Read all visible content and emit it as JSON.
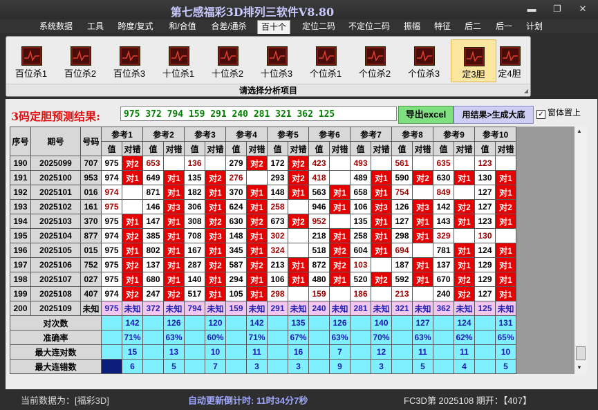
{
  "app": {
    "title": "第七感福彩3D排列三软件V8.80"
  },
  "window_controls": {
    "minimize": "▬",
    "restore": "❐",
    "close": "✕"
  },
  "menu": [
    "系统数据",
    "工具",
    "跨度/复式",
    "和/合值",
    "合差/通杀",
    "百十个",
    "定位二码",
    "不定位二码",
    "振幅",
    "特征",
    "后二",
    "后一",
    "计划"
  ],
  "ribbon": {
    "buttons": [
      "百位杀1",
      "百位杀2",
      "百位杀3",
      "十位杀1",
      "十位杀2",
      "十位杀3",
      "个位杀1",
      "个位杀2",
      "个位杀3",
      "定3胆",
      "定4胆"
    ],
    "caption": "请选择分析项目",
    "corner": "◢"
  },
  "prediction": {
    "label": "3码定胆预测结果:",
    "values": "975 372 794 159 291 240 281 321 362 125",
    "export_label": "导出excel",
    "generate_label": "用结果>生成大底",
    "topmost_label": "窗体置上",
    "topmost_check": "✓"
  },
  "table": {
    "headers": {
      "seq": "序号",
      "period": "期号",
      "number": "号码",
      "val": "值",
      "judge": "对错"
    },
    "refs": [
      "参考1",
      "参考2",
      "参考3",
      "参考4",
      "参考5",
      "参考6",
      "参考7",
      "参考8",
      "参考9",
      "参考10"
    ],
    "rows": [
      {
        "seq": "190",
        "period": "2025099",
        "number": "707",
        "cells": [
          [
            "975",
            "对2"
          ],
          [
            "653",
            ""
          ],
          [
            "136",
            ""
          ],
          [
            "279",
            "对2"
          ],
          [
            "172",
            "对2"
          ],
          [
            "423",
            ""
          ],
          [
            "493",
            ""
          ],
          [
            "561",
            ""
          ],
          [
            "635",
            ""
          ],
          [
            "123",
            ""
          ]
        ]
      },
      {
        "seq": "191",
        "period": "2025100",
        "number": "953",
        "cells": [
          [
            "974",
            "对1"
          ],
          [
            "649",
            "对1"
          ],
          [
            "135",
            "对2"
          ],
          [
            "276",
            ""
          ],
          [
            "293",
            "对2"
          ],
          [
            "418",
            ""
          ],
          [
            "489",
            "对1"
          ],
          [
            "590",
            "对2"
          ],
          [
            "630",
            "对1"
          ],
          [
            "130",
            "对1"
          ]
        ]
      },
      {
        "seq": "192",
        "period": "2025101",
        "number": "016",
        "cells": [
          [
            "974",
            ""
          ],
          [
            "871",
            "对1"
          ],
          [
            "182",
            "对1"
          ],
          [
            "370",
            "对1"
          ],
          [
            "148",
            "对1"
          ],
          [
            "563",
            "对1"
          ],
          [
            "658",
            "对1"
          ],
          [
            "754",
            ""
          ],
          [
            "849",
            ""
          ],
          [
            "127",
            "对1"
          ]
        ]
      },
      {
        "seq": "193",
        "period": "2025102",
        "number": "161",
        "cells": [
          [
            "975",
            ""
          ],
          [
            "146",
            "对3"
          ],
          [
            "306",
            "对1"
          ],
          [
            "624",
            "对1"
          ],
          [
            "258",
            ""
          ],
          [
            "946",
            "对1"
          ],
          [
            "106",
            "对3"
          ],
          [
            "126",
            "对3"
          ],
          [
            "142",
            "对2"
          ],
          [
            "127",
            "对2"
          ]
        ]
      },
      {
        "seq": "194",
        "period": "2025103",
        "number": "370",
        "cells": [
          [
            "975",
            "对1"
          ],
          [
            "147",
            "对1"
          ],
          [
            "308",
            "对2"
          ],
          [
            "630",
            "对2"
          ],
          [
            "673",
            "对2"
          ],
          [
            "952",
            ""
          ],
          [
            "135",
            "对1"
          ],
          [
            "127",
            "对1"
          ],
          [
            "143",
            "对1"
          ],
          [
            "123",
            "对1"
          ]
        ]
      },
      {
        "seq": "195",
        "period": "2025104",
        "number": "877",
        "cells": [
          [
            "974",
            "对2"
          ],
          [
            "385",
            "对1"
          ],
          [
            "708",
            "对3"
          ],
          [
            "148",
            "对1"
          ],
          [
            "302",
            ""
          ],
          [
            "218",
            "对1"
          ],
          [
            "258",
            "对1"
          ],
          [
            "298",
            "对1"
          ],
          [
            "329",
            ""
          ],
          [
            "130",
            ""
          ]
        ]
      },
      {
        "seq": "196",
        "period": "2025105",
        "number": "015",
        "cells": [
          [
            "975",
            "对1"
          ],
          [
            "802",
            "对1"
          ],
          [
            "167",
            "对1"
          ],
          [
            "345",
            "对1"
          ],
          [
            "324",
            ""
          ],
          [
            "518",
            "对2"
          ],
          [
            "604",
            "对1"
          ],
          [
            "694",
            ""
          ],
          [
            "781",
            "对1"
          ],
          [
            "124",
            "对1"
          ]
        ]
      },
      {
        "seq": "197",
        "period": "2025106",
        "number": "752",
        "cells": [
          [
            "975",
            "对2"
          ],
          [
            "137",
            "对1"
          ],
          [
            "287",
            "对2"
          ],
          [
            "587",
            "对2"
          ],
          [
            "213",
            "对1"
          ],
          [
            "872",
            "对2"
          ],
          [
            "103",
            ""
          ],
          [
            "187",
            "对1"
          ],
          [
            "137",
            "对1"
          ],
          [
            "129",
            "对1"
          ]
        ]
      },
      {
        "seq": "198",
        "period": "2025107",
        "number": "027",
        "cells": [
          [
            "975",
            "对1"
          ],
          [
            "680",
            "对1"
          ],
          [
            "140",
            "对1"
          ],
          [
            "294",
            "对1"
          ],
          [
            "106",
            "对1"
          ],
          [
            "480",
            "对1"
          ],
          [
            "520",
            "对2"
          ],
          [
            "592",
            "对1"
          ],
          [
            "670",
            "对2"
          ],
          [
            "129",
            "对1"
          ]
        ]
      },
      {
        "seq": "199",
        "period": "2025108",
        "number": "407",
        "cells": [
          [
            "974",
            "对2"
          ],
          [
            "247",
            "对2"
          ],
          [
            "517",
            "对1"
          ],
          [
            "105",
            "对1"
          ],
          [
            "298",
            ""
          ],
          [
            "159",
            ""
          ],
          [
            "186",
            ""
          ],
          [
            "213",
            ""
          ],
          [
            "240",
            "对2"
          ],
          [
            "127",
            "对1"
          ]
        ]
      }
    ],
    "pending": {
      "seq": "200",
      "period": "2025109",
      "number": "未知",
      "cells": [
        [
          "975",
          "未知"
        ],
        [
          "372",
          "未知"
        ],
        [
          "794",
          "未知"
        ],
        [
          "159",
          "未知"
        ],
        [
          "291",
          "未知"
        ],
        [
          "240",
          "未知"
        ],
        [
          "281",
          "未知"
        ],
        [
          "321",
          "未知"
        ],
        [
          "362",
          "未知"
        ],
        [
          "125",
          "未知"
        ]
      ]
    },
    "stats": [
      {
        "label": "对次数",
        "values": [
          "142",
          "126",
          "120",
          "142",
          "135",
          "126",
          "140",
          "127",
          "124",
          "131"
        ]
      },
      {
        "label": "准确率",
        "values": [
          "71%",
          "63%",
          "60%",
          "71%",
          "67%",
          "63%",
          "70%",
          "63%",
          "62%",
          "65%"
        ]
      },
      {
        "label": "最大连对数",
        "values": [
          "15",
          "13",
          "10",
          "11",
          "16",
          "7",
          "12",
          "11",
          "11",
          "10"
        ]
      },
      {
        "label": "最大连错数",
        "values": [
          "6",
          "5",
          "7",
          "3",
          "3",
          "9",
          "3",
          "5",
          "4",
          "5"
        ]
      }
    ]
  },
  "scrollbar": {
    "up": "▲",
    "down": "▼"
  },
  "status": {
    "current_data": "当前数据为：[福彩3D]",
    "countdown": "自动更新倒计时:  11时34分7秒",
    "last_draw": "FC3D第 2025108 期开：【407】"
  },
  "colors": {
    "hit": "#e60000",
    "stat_bg": "#7ff0ff",
    "pending_bg": "#f3c6f0",
    "prediction_text": "#008000"
  }
}
